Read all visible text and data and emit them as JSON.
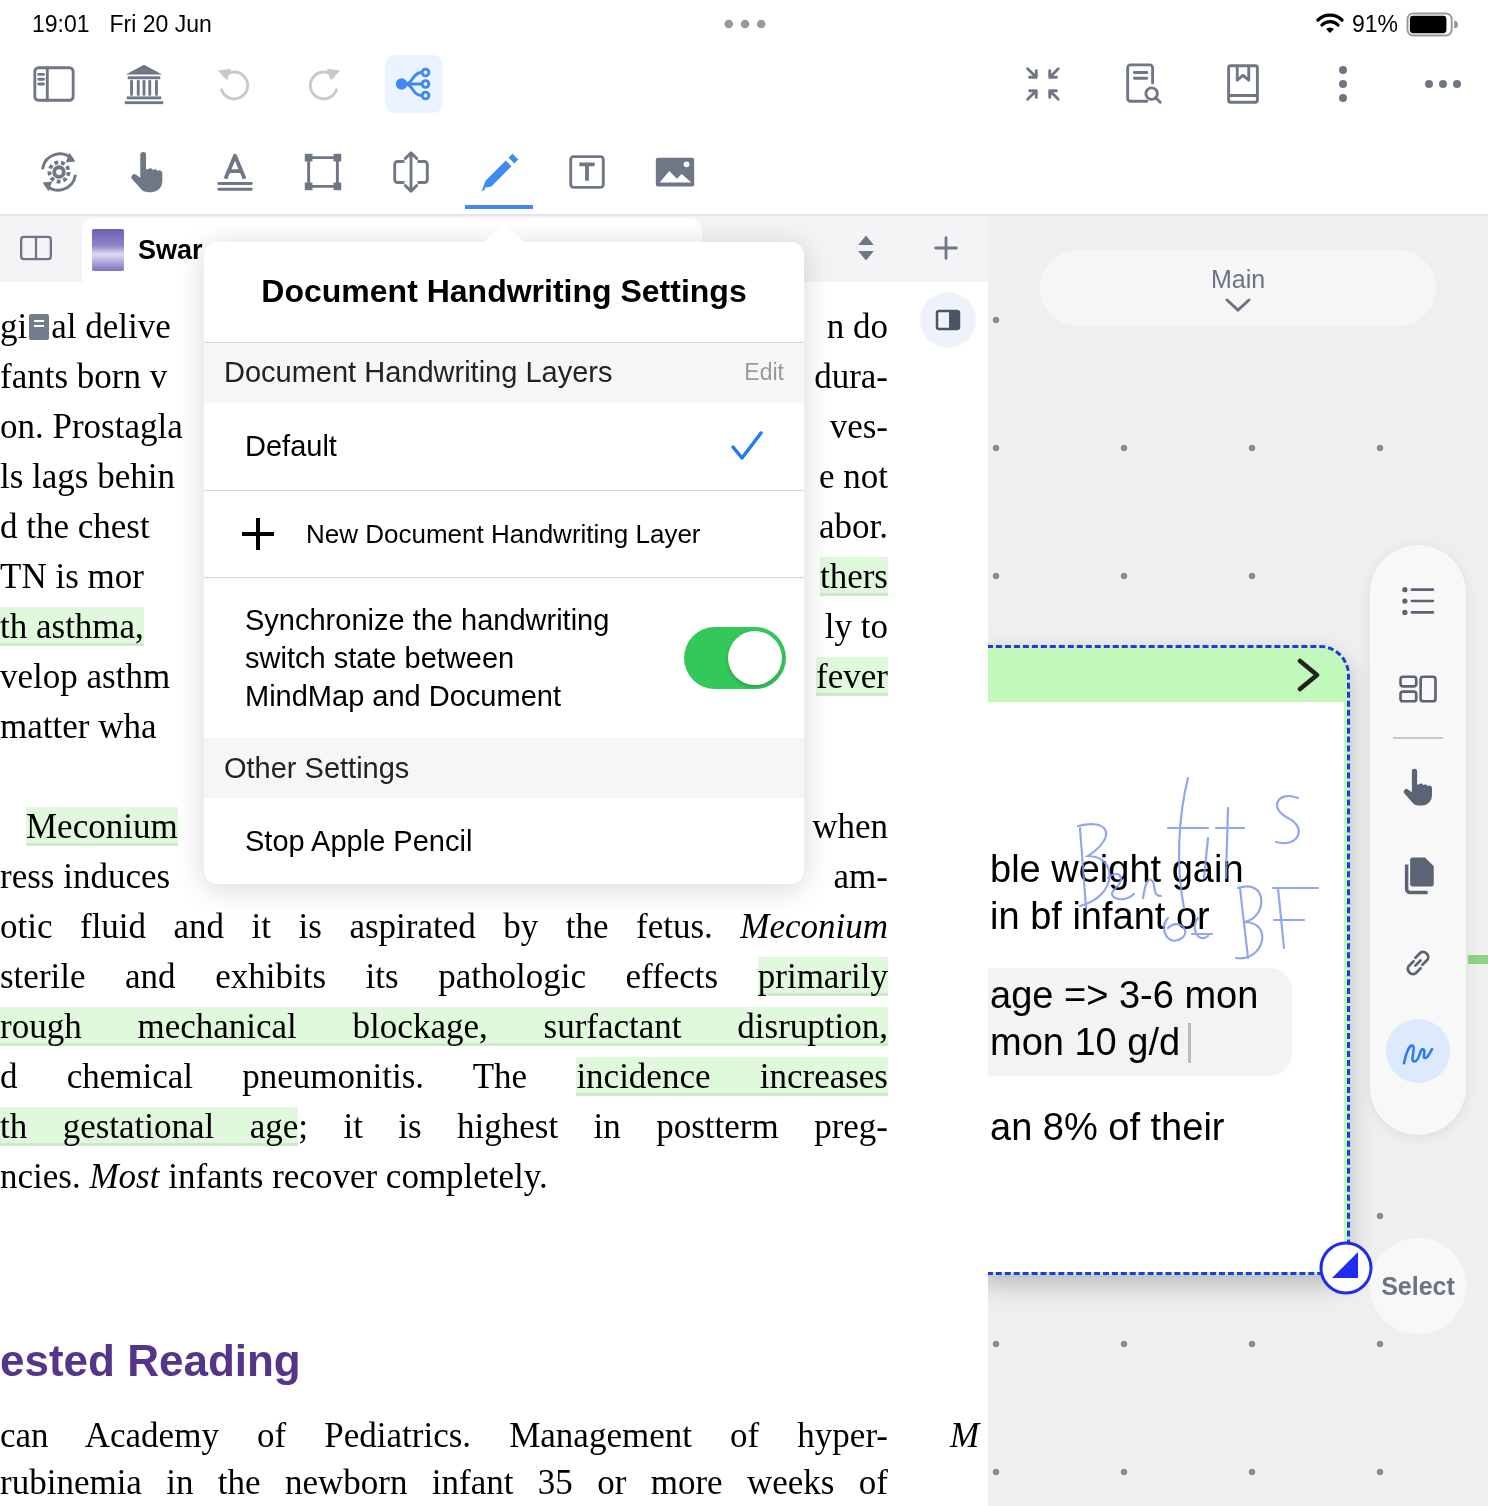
{
  "status_bar": {
    "time": "19:01",
    "date": "Fri 20 Jun",
    "battery": "91%"
  },
  "toolbar": {
    "left": [
      {
        "kind": "sidebar",
        "selected": false,
        "disabled": false
      },
      {
        "kind": "library",
        "selected": false,
        "disabled": false
      },
      {
        "kind": "undo",
        "selected": false,
        "disabled": true
      },
      {
        "kind": "redo",
        "selected": false,
        "disabled": true
      },
      {
        "kind": "mindmap",
        "selected": true,
        "disabled": false
      }
    ],
    "right": [
      {
        "kind": "collapse"
      },
      {
        "kind": "doc-search"
      },
      {
        "kind": "bookmark-book"
      },
      {
        "kind": "vertical-dots"
      },
      {
        "kind": "horizontal-dots"
      }
    ]
  },
  "tools": [
    {
      "kind": "rotate-gear",
      "selected": false
    },
    {
      "kind": "hand",
      "selected": false
    },
    {
      "kind": "text-style",
      "selected": false
    },
    {
      "kind": "select-rect",
      "selected": false
    },
    {
      "kind": "resize-frame",
      "selected": false
    },
    {
      "kind": "pen",
      "selected": true
    },
    {
      "kind": "text-box",
      "selected": false
    },
    {
      "kind": "image",
      "selected": false
    }
  ],
  "document": {
    "tab": {
      "title": "Swar"
    },
    "paragraphs": [
      {
        "kind": "plain",
        "lines": [
          {
            "kind": "split",
            "left": [
              {
                "kind": "text",
                "text": "gi"
              },
              {
                "kind": "note"
              },
              {
                "kind": "text",
                "text": "al delive"
              }
            ],
            "right": [
              {
                "text": "n do"
              }
            ]
          },
          {
            "kind": "split",
            "left": [
              {
                "text": "fants born v"
              }
            ],
            "right": [
              {
                "text": "dura-"
              }
            ]
          },
          {
            "kind": "split",
            "left": [
              {
                "text": "on. Prostagla"
              }
            ],
            "right": [
              {
                "text": "ves-"
              }
            ]
          },
          {
            "kind": "split",
            "left": [
              {
                "text": "ls lags behin"
              }
            ],
            "right": [
              {
                "text": "e not"
              }
            ]
          },
          {
            "kind": "split",
            "left": [
              {
                "text": "d the chest"
              }
            ],
            "right": [
              {
                "text": "abor."
              }
            ]
          },
          {
            "kind": "split",
            "left": [
              {
                "text": "TN is mor"
              }
            ],
            "right": [
              {
                "text": "thers",
                "highlighted": true
              }
            ]
          },
          {
            "kind": "split",
            "left": [
              {
                "text": "th asthma,",
                "highlighted": true
              }
            ],
            "right": [
              {
                "text": "ly to"
              }
            ]
          },
          {
            "kind": "split",
            "left": [
              {
                "text": "velop asthm"
              }
            ],
            "right": [
              {
                "text": "fever",
                "highlighted": true
              }
            ]
          },
          {
            "kind": "split",
            "left": [
              {
                "text": "matter wha"
              }
            ]
          }
        ]
      },
      {
        "kind": "indented",
        "lines": [
          {
            "kind": "split",
            "left": [
              {
                "text": "Meconium",
                "highlighted": true
              }
            ],
            "right": [
              {
                "text": "when"
              }
            ]
          },
          {
            "kind": "split",
            "left": [
              {
                "text": "ress induces"
              }
            ],
            "right": [
              {
                "text": "am-"
              }
            ]
          },
          {
            "kind": "full",
            "segments": [
              {
                "text": "otic fluid and it is aspirated by the fetus. *Meconium*"
              }
            ]
          },
          {
            "kind": "full",
            "segments": [
              {
                "text": "sterile and exhibits its pathologic effects "
              },
              {
                "text": "primarily",
                "highlighted": true
              }
            ]
          },
          {
            "kind": "full",
            "segments": [
              {
                "text": "rough mechanical blockage, surfactant disruption,",
                "highlighted": true
              }
            ]
          },
          {
            "kind": "full",
            "segments": [
              {
                "text": "d chemical pneumonitis. The "
              },
              {
                "text": "incidence increases",
                "highlighted": true
              }
            ]
          },
          {
            "kind": "full",
            "segments": [
              {
                "text": "th gestational age",
                "highlighted": true
              },
              {
                "text": "; it is highest in postterm preg-"
              }
            ]
          },
          {
            "kind": "end",
            "segments": [
              {
                "text": "ncies. *Most* infants recover completely."
              }
            ]
          }
        ]
      }
    ],
    "heading": "ested Reading",
    "references": [
      "can Academy of Pediatrics. Management of hyper-",
      "rubinemia in the newborn infant 35 or more weeks of"
    ],
    "margin_text": "M"
  },
  "popover": {
    "title": "Document Handwriting Settings",
    "layers_header": "Document Handwriting Layers",
    "edit": "Edit",
    "layers": [
      {
        "label": "Default",
        "selected": true
      }
    ],
    "new_layer": "New Document Handwriting Layer",
    "sync": {
      "label": "Synchronize the handwriting switch state between MindMap and Document",
      "on": true
    },
    "other_header": "Other Settings",
    "stop_pencil": "Stop Apple Pencil"
  },
  "mindmap": {
    "main_button": "Main",
    "node": {
      "blocks": [
        {
          "kind": "text",
          "lines": [
            "ble weight gain",
            "in bf infant or"
          ]
        },
        {
          "kind": "box",
          "lines": [
            "age => 3-6 mon",
            "mon 10 g/d"
          ]
        },
        {
          "kind": "text",
          "lines": [
            "an 8% of their"
          ]
        }
      ]
    },
    "palette": [
      {
        "kind": "list",
        "selected": false
      },
      {
        "kind": "layout",
        "selected": false
      },
      {
        "kind": "divider"
      },
      {
        "kind": "hand",
        "selected": false
      },
      {
        "kind": "copy",
        "selected": false
      },
      {
        "kind": "link",
        "selected": false
      },
      {
        "kind": "scribble",
        "selected": true
      }
    ],
    "select_button": "Select"
  }
}
